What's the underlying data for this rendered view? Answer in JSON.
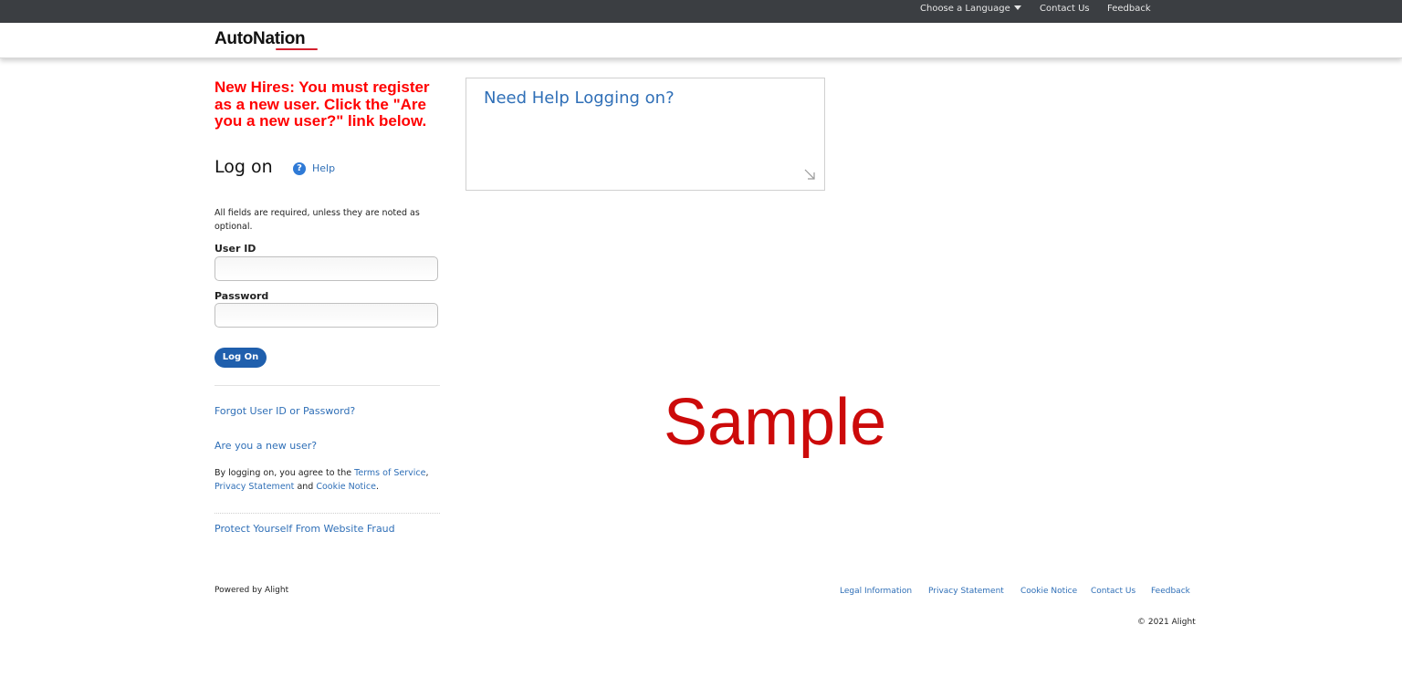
{
  "topbar": {
    "language_label": "Choose a Language",
    "contact_label": "Contact Us",
    "feedback_label": "Feedback"
  },
  "header": {
    "logo_text": "AutoNation",
    "brand_accent": "#d4202e"
  },
  "notice": {
    "text": "New Hires: You must register as a new user. Click the \"Are you a new user?\" link below."
  },
  "login": {
    "title": "Log on",
    "help_icon": "?",
    "help_label": "Help",
    "required_note": "All fields are required, unless they are noted as optional.",
    "user_id_label": "User ID",
    "user_id_value": "",
    "password_label": "Password",
    "password_value": "",
    "logon_button": "Log On",
    "forgot_link": "Forgot User ID or Password?",
    "new_user_link": "Are you a new user?",
    "agree_prefix": "By logging on, you agree to the ",
    "terms_link": "Terms of Service",
    "agree_comma": ",",
    "privacy_link": "Privacy Statement",
    "agree_and": " and ",
    "cookie_link": "Cookie Notice",
    "agree_period": ".",
    "fraud_link": "Protect Yourself From Website Fraud"
  },
  "help_panel": {
    "title": "Need Help Logging on?",
    "expand_icon": "expand-arrow-icon"
  },
  "watermark": {
    "text": "Sample"
  },
  "footer": {
    "powered_by": "Powered by Alight",
    "links": {
      "legal": "Legal Information",
      "privacy": "Privacy Statement",
      "cookie": "Cookie Notice",
      "contact": "Contact Us",
      "feedback": "Feedback"
    },
    "copyright": "© 2021 Alight"
  },
  "colors": {
    "topbar_bg": "#3b3e42",
    "notice_red": "#ff0000",
    "link_blue": "#2f6fb7",
    "button_blue": "#1f5fad",
    "watermark_red": "#cc0a0a"
  }
}
